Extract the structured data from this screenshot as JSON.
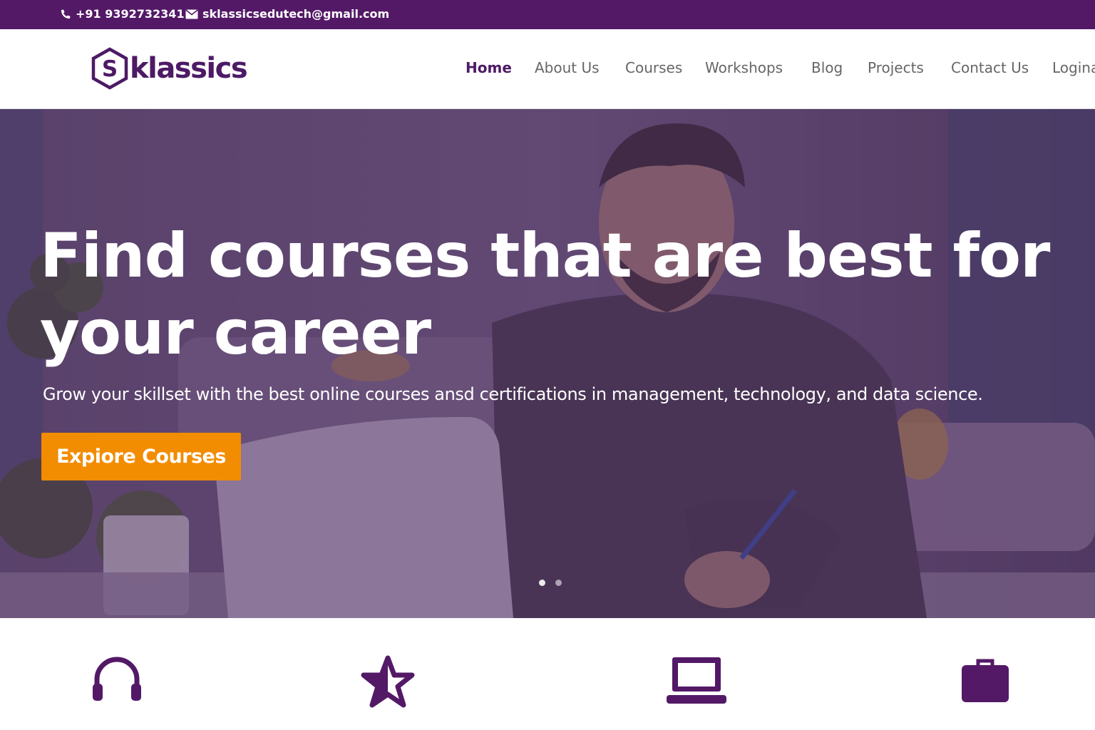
{
  "topbar": {
    "phone": "+91 9392732341",
    "email": "sklassicsedutech@gmail.com",
    "phone_icon": "phone-icon",
    "email_icon": "envelope-icon"
  },
  "brand": {
    "logo_letter": "S",
    "name": "klassics",
    "color": "#4d1a66"
  },
  "nav": {
    "items": [
      {
        "label": "Home",
        "active": true
      },
      {
        "label": "About Us"
      },
      {
        "label": "Courses"
      },
      {
        "label": "Workshops"
      },
      {
        "label": "Blog"
      },
      {
        "label": "Projects"
      },
      {
        "label": "Contact Us"
      },
      {
        "label": "Logina"
      }
    ]
  },
  "hero": {
    "title_line1": "Find courses that are best for",
    "title_line2": "your career",
    "subtitle": "Grow your skillset with the best online courses ansd certifications in management, technology, and data science.",
    "button_label": "Expiore Courses",
    "button_color": "#f28c00",
    "slides": 2,
    "active_slide": 1
  },
  "features": {
    "icons": [
      "headphones-icon",
      "star-icon",
      "laptop-icon",
      "briefcase-icon"
    ],
    "icon_color": "#531967"
  },
  "colors": {
    "topbar_bg": "#531967",
    "accent": "#4d1a66",
    "cta": "#f28c00"
  }
}
